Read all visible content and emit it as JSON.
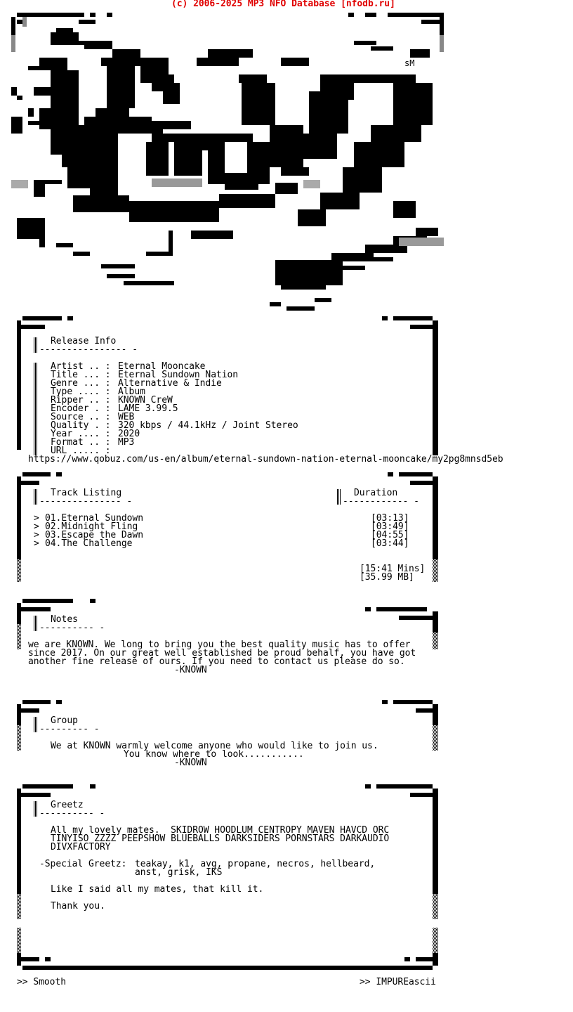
{
  "header": {
    "copyright": "(c) 2006-2025 MP3 NFO Database [nfodb.ru]"
  },
  "logo": {
    "signature": "sM",
    "accent": "#000000"
  },
  "release_info": {
    "title": "Release Info",
    "underline": "---------------- -",
    "fields": [
      {
        "label": "Artist .. :",
        "value": "Eternal Mooncake"
      },
      {
        "label": "Title ... :",
        "value": "Eternal Sundown Nation"
      },
      {
        "label": "Genre ... :",
        "value": "Alternative & Indie"
      },
      {
        "label": "Type .... :",
        "value": "Album"
      },
      {
        "label": "Ripper .. :",
        "value": "KNOWN CreW"
      },
      {
        "label": "Encoder . :",
        "value": "LAME 3.99.5"
      },
      {
        "label": "Source .. :",
        "value": "WEB"
      },
      {
        "label": "Quality . :",
        "value": "320 kbps / 44.1kHz / Joint Stereo"
      },
      {
        "label": "Year .... :",
        "value": "2020"
      },
      {
        "label": "Format .. :",
        "value": "MP3"
      },
      {
        "label": "URL ..... :",
        "value": ""
      }
    ],
    "url": "https://www.qobuz.com/us-en/album/eternal-sundown-nation-eternal-mooncake/my2pg8mnsd5eb"
  },
  "tracks": {
    "title": "Track Listing",
    "title_underline": "--------------- -",
    "duration_title": "Duration",
    "duration_underline": "------------ -",
    "items": [
      {
        "bullet": ">",
        "name": "01.Eternal Sundown",
        "duration": "[03:13]"
      },
      {
        "bullet": ">",
        "name": "02.Midnight Fling",
        "duration": "[03:49]"
      },
      {
        "bullet": ">",
        "name": "03.Escape the Dawn",
        "duration": "[04:55]"
      },
      {
        "bullet": ">",
        "name": "04.The Challenge",
        "duration": "[03:44]"
      }
    ],
    "total_time": "[15:41 Mins]",
    "total_size": "[35.99 MB]"
  },
  "notes": {
    "title": "Notes",
    "underline": "---------- -",
    "lines": [
      "we are KNOWN. We long to bring you the best quality music has to offer",
      "since 2017. On our great well established be proud behalf, you have got",
      "another fine release of ours. If you need to contact us please do so."
    ],
    "signature": "-KNOWN"
  },
  "group": {
    "title": "Group",
    "underline": "--------- -",
    "lines": [
      "We at KNOWN warmly welcome anyone who would like to join us.",
      "You know where to look..........."
    ],
    "signature": "-KNOWN"
  },
  "greetz": {
    "title": "Greetz",
    "underline": "---------- -",
    "groups_lines": [
      "All my lovely mates.  SKIDROW HOODLUM CENTROPY MAVEN HAVCD ORC",
      "TINYISO ZZZZ PEEPSHOW BLUEBALLS DARKSIDERS PORNSTARS DARKAUDIO",
      "DIVXFACTORY"
    ],
    "special_label": "-Special Greetz:",
    "special_lines": [
      "teakay, k1, avg, propane, necros, hellbeard,",
      "anst, grisk, IKS"
    ],
    "closing": "Like I said all my mates, that kill it.",
    "thanks": "Thank you."
  },
  "footer": {
    "left": ">> Smooth",
    "right": ">> IMPUREascii"
  }
}
